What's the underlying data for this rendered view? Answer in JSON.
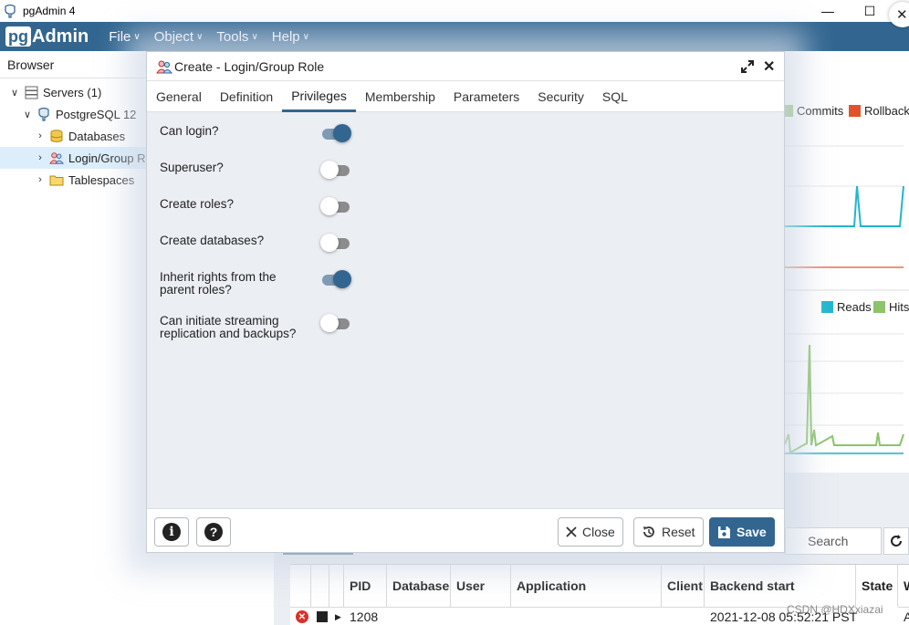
{
  "window": {
    "title": "pgAdmin 4"
  },
  "menubar": {
    "logo_pg": "pg",
    "logo_admin": "Admin",
    "items": [
      "File",
      "Object",
      "Tools",
      "Help"
    ]
  },
  "browser": {
    "header": "Browser",
    "tree": [
      {
        "label": "Servers (1)",
        "expanded": true
      },
      {
        "label": "PostgreSQL 12",
        "expanded": true
      },
      {
        "label": "Databases",
        "expanded": false
      },
      {
        "label": "Login/Group R",
        "expanded": false,
        "selected": true
      },
      {
        "label": "Tablespaces",
        "expanded": false
      }
    ]
  },
  "dashboard": {
    "legend_top": [
      {
        "label": "Commits",
        "color": "#8cc36b"
      },
      {
        "label": "Rollback",
        "color": "#e2532a"
      }
    ],
    "legend_bottom": [
      {
        "label": "Reads",
        "color": "#22b5cf"
      },
      {
        "label": "Hits",
        "color": "#8cc36b"
      }
    ]
  },
  "dialog": {
    "title": "Create - Login/Group Role",
    "tabs": [
      "General",
      "Definition",
      "Privileges",
      "Membership",
      "Parameters",
      "Security",
      "SQL"
    ],
    "active_tab": "Privileges",
    "fields": [
      {
        "label": "Can login?",
        "on": true
      },
      {
        "label": "Superuser?",
        "on": false
      },
      {
        "label": "Create roles?",
        "on": false
      },
      {
        "label": "Create databases?",
        "on": false
      },
      {
        "label": "Inherit rights from the parent roles?",
        "on": true
      },
      {
        "label": "Can initiate streaming replication and backups?",
        "on": false
      }
    ],
    "footer": {
      "info_glyph": "i",
      "help_glyph": "?",
      "close_label": "Close",
      "reset_label": "Reset",
      "save_label": "Save"
    }
  },
  "activity": {
    "search_placeholder": "Search",
    "columns": [
      "PID",
      "Database",
      "User",
      "Application",
      "Client",
      "Backend start",
      "State",
      "W"
    ],
    "rows": [
      {
        "pid": "1208",
        "backend_start": "2021-12-08 05:52:21 PST",
        "state": "A"
      }
    ]
  },
  "colors": {
    "brand": "#326690",
    "reads": "#22b5cf",
    "hits": "#8cc36b",
    "rollback": "#e2532a"
  },
  "watermark": "CSDN @HDXxiazai"
}
